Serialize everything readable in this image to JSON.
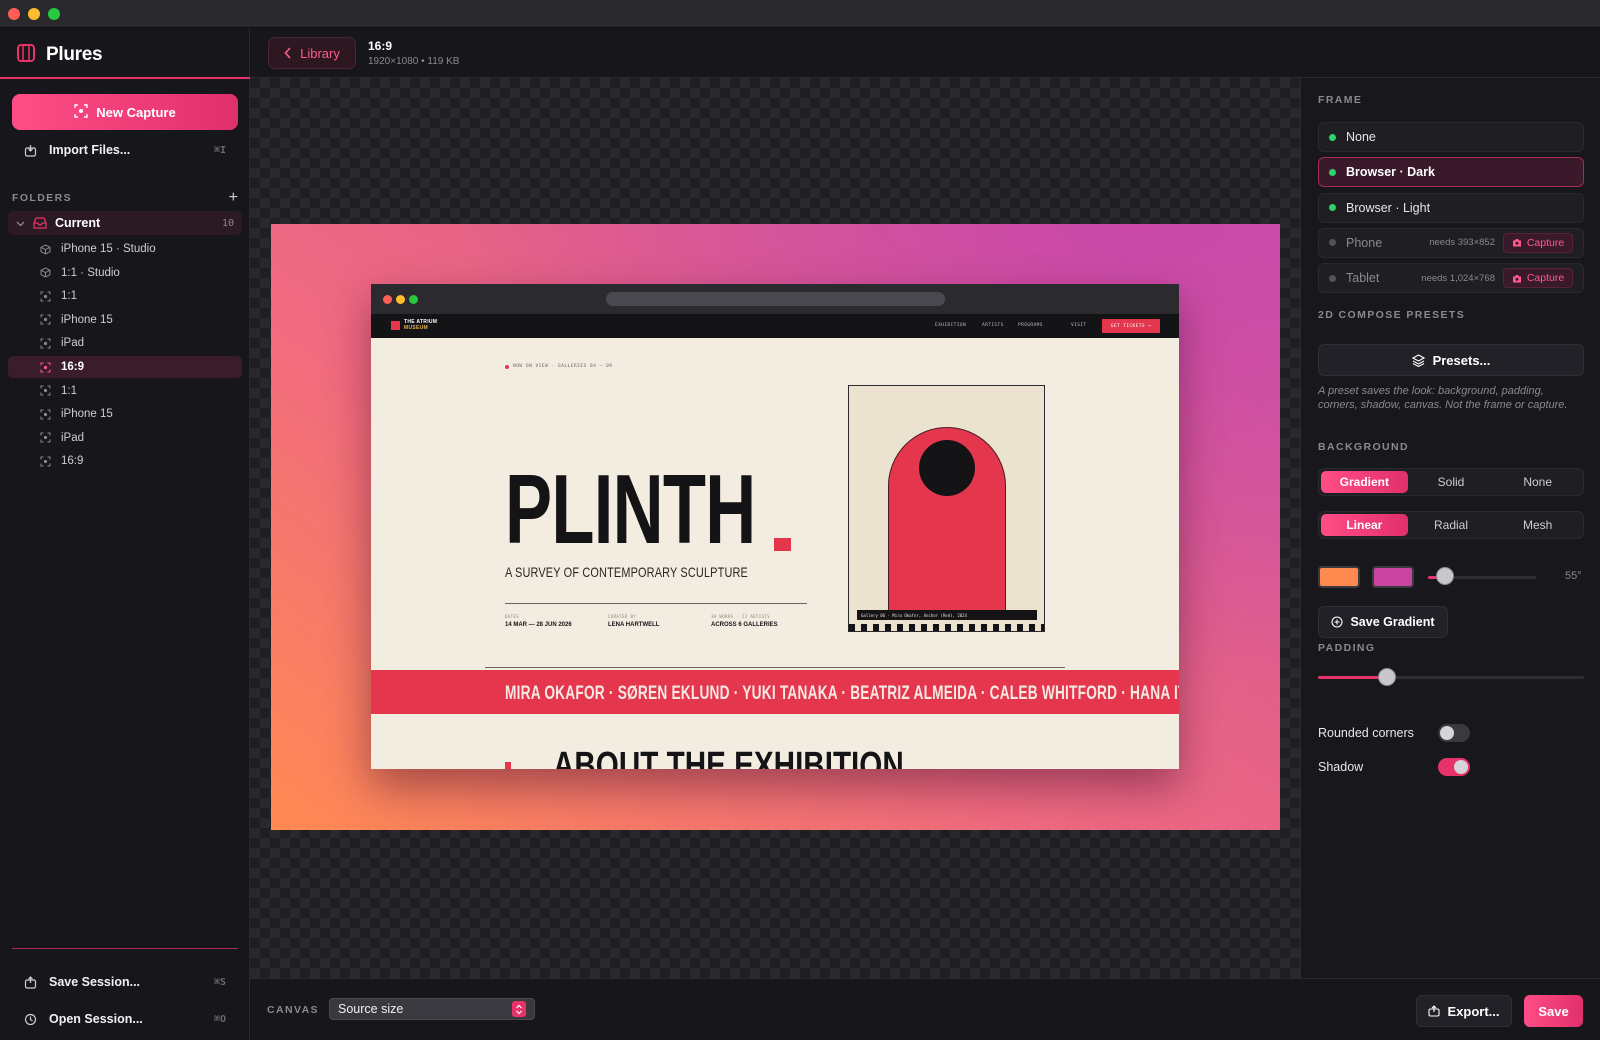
{
  "window": {
    "controls": {
      "close": "#ff5f57",
      "minimize": "#febc2e",
      "zoom": "#28c840"
    }
  },
  "app": {
    "name": "Plures",
    "accent": "#e8336a"
  },
  "sidebar": {
    "new_capture": "New Capture",
    "import": {
      "label": "Import Files...",
      "shortcut": "⌘I"
    },
    "folders_heading": "FOLDERS",
    "add_symbol": "+",
    "folder": {
      "name": "Current",
      "count": "10"
    },
    "items": [
      {
        "label": "iPhone 15 · Studio",
        "icon": "cube-icon",
        "active": false
      },
      {
        "label": "1:1 · Studio",
        "icon": "cube-icon",
        "active": false
      },
      {
        "label": "1:1",
        "icon": "capture-icon",
        "active": false
      },
      {
        "label": "iPhone 15",
        "icon": "capture-icon",
        "active": false
      },
      {
        "label": "iPad",
        "icon": "capture-icon",
        "active": false
      },
      {
        "label": "16:9",
        "icon": "capture-icon",
        "active": true
      },
      {
        "label": "1:1",
        "icon": "capture-icon",
        "active": false
      },
      {
        "label": "iPhone 15",
        "icon": "capture-icon",
        "active": false
      },
      {
        "label": "iPad",
        "icon": "capture-icon",
        "active": false
      },
      {
        "label": "16:9",
        "icon": "capture-icon",
        "active": false
      }
    ],
    "save_session": {
      "label": "Save Session...",
      "shortcut": "⌘S"
    },
    "open_session": {
      "label": "Open Session...",
      "shortcut": "⌘O"
    }
  },
  "header": {
    "back_label": "Library",
    "title": "16:9",
    "meta": "1920×1080 • 119 KB"
  },
  "preview": {
    "nav_brand_line1": "THE ATRIUM",
    "nav_brand_line2": "MUSEUM",
    "nav_links": [
      "EXHIBITION",
      "ARTISTS",
      "PROGRAMS",
      "VISIT"
    ],
    "nav_cta": "GET TICKETS →",
    "view_tag": "NOW ON VIEW · GALLERIES 04 — 09",
    "headline": "PLINTH",
    "subhead": "A SURVEY OF CONTEMPORARY SCULPTURE",
    "meta": [
      {
        "key": "DATES",
        "value": "14 MAR — 28 JUN 2026"
      },
      {
        "key": "CURATED BY",
        "value": "LENA HARTWELL"
      },
      {
        "key": "38 WORKS · 22 ARTISTS",
        "value": "ACROSS 6 GALLERIES"
      }
    ],
    "poster_caption": "Gallery 06 · Mira Okafor, Anchor (Red), 2024",
    "ticker": "MIRA OKAFOR  ·  SØREN EKLUND  ·  YUKI TANAKA  ·  BEATRIZ ALMEIDA  ·  CALEB WHITFORD  ·  HANA ITŌ  ·  MAR",
    "section_title": "ABOUT THE EXHIBITION"
  },
  "panel": {
    "frame_heading": "FRAME",
    "frames": [
      {
        "label": "None",
        "selected": false,
        "available": true
      },
      {
        "label": "Browser · Dark",
        "selected": true,
        "available": true
      },
      {
        "label": "Browser · Light",
        "selected": false,
        "available": true
      },
      {
        "label": "Phone",
        "selected": false,
        "available": false,
        "need": "needs 393×852",
        "action": "Capture"
      },
      {
        "label": "Tablet",
        "selected": false,
        "available": false,
        "need": "needs 1,024×768",
        "action": "Capture"
      }
    ],
    "presets_heading": "2D COMPOSE PRESETS",
    "presets_button": "Presets...",
    "presets_hint": "A preset saves the look: background, padding, corners, shadow, canvas. Not the frame or capture.",
    "background_heading": "BACKGROUND",
    "bg_types": [
      {
        "label": "Gradient",
        "on": true
      },
      {
        "label": "Solid",
        "on": false
      },
      {
        "label": "None",
        "on": false
      }
    ],
    "gradient_types": [
      {
        "label": "Linear",
        "on": true
      },
      {
        "label": "Radial",
        "on": false
      },
      {
        "label": "Mesh",
        "on": false
      }
    ],
    "color_stops": [
      "#ff8a4f",
      "#c8449e"
    ],
    "angle_value": 55,
    "angle_label": "55°",
    "save_gradient": "Save Gradient",
    "padding_heading": "PADDING",
    "padding_level": 0.26,
    "rounded_label": "Rounded corners",
    "rounded_on": false,
    "shadow_label": "Shadow",
    "shadow_on": true
  },
  "bottom": {
    "canvas_label": "CANVAS",
    "canvas_value": "Source size",
    "export": "Export...",
    "save": "Save"
  }
}
